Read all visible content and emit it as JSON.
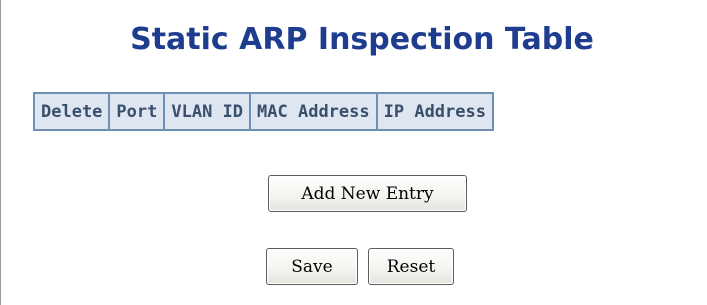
{
  "page": {
    "title": "Static ARP Inspection Table"
  },
  "table": {
    "columns": [
      "Delete",
      "Port",
      "VLAN ID",
      "MAC Address",
      "IP Address"
    ],
    "rows": []
  },
  "buttons": {
    "add_new_entry": "Add New Entry",
    "save": "Save",
    "reset": "Reset"
  },
  "colors": {
    "title": "#1f3d8f",
    "table_border": "#6f8fb4",
    "header_background": "#dde6f1",
    "header_text": "#3a4f6b"
  }
}
